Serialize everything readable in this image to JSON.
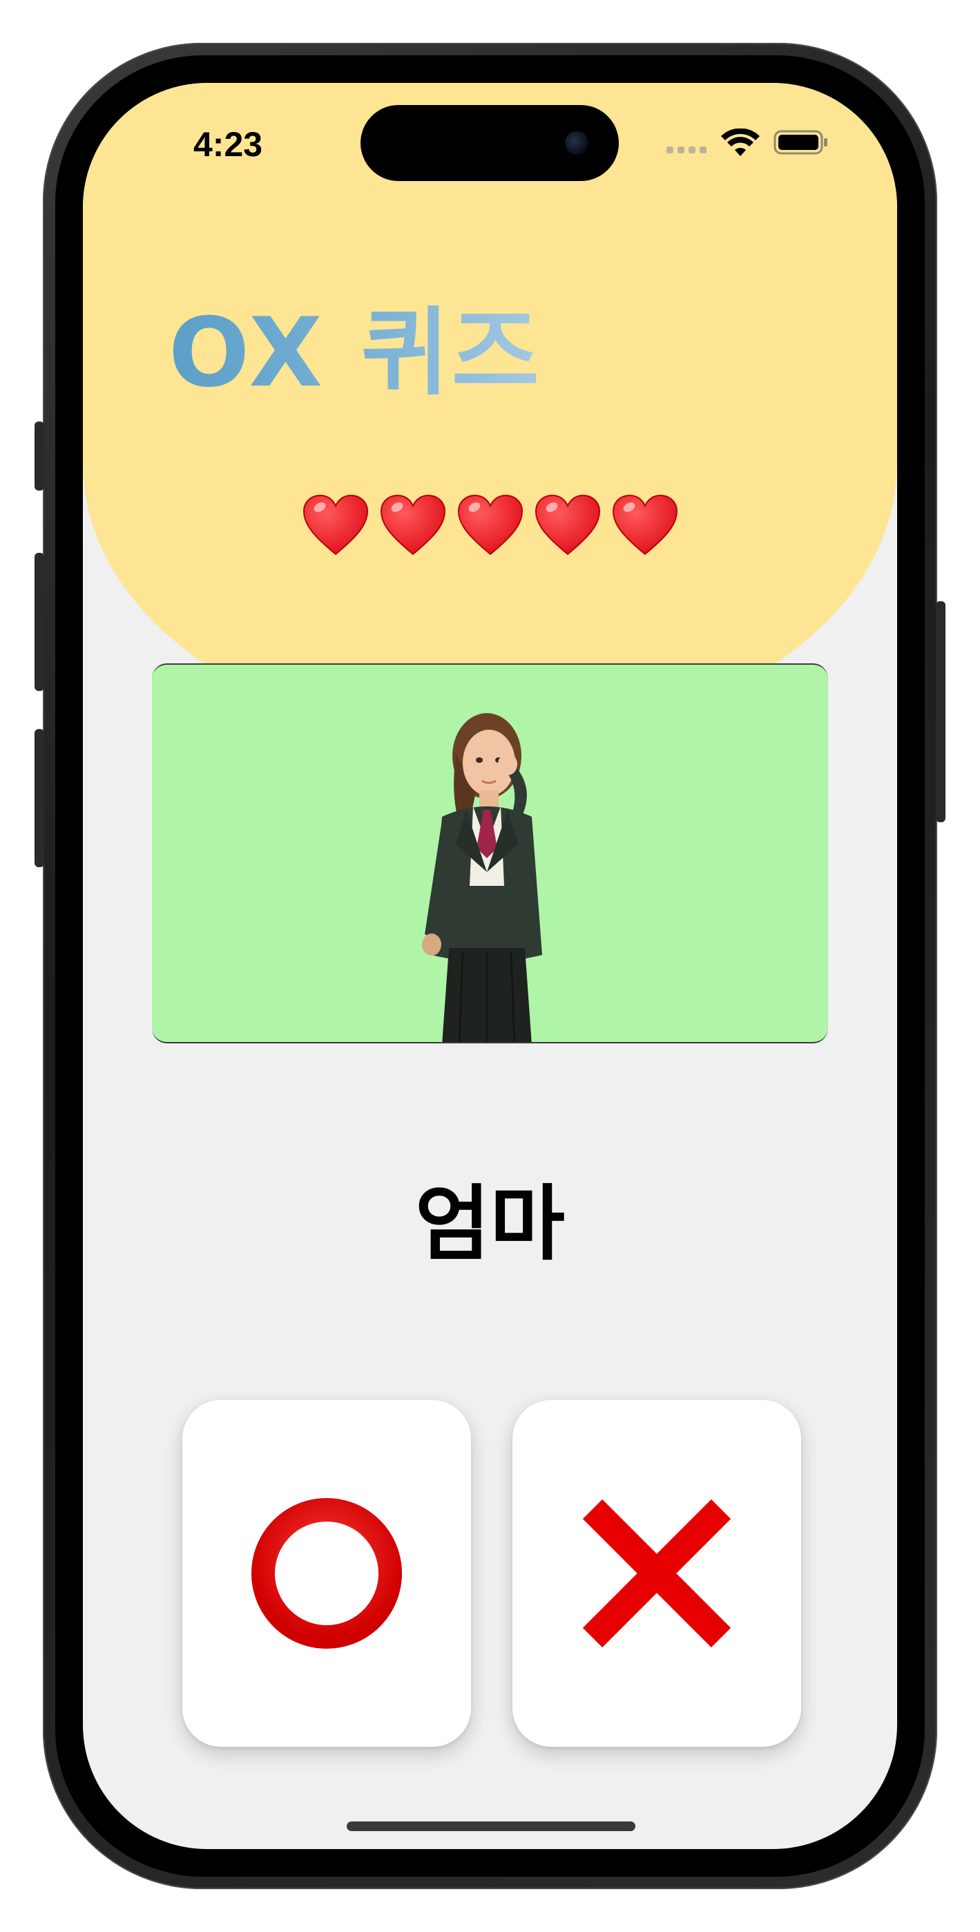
{
  "status_bar": {
    "time": "4:23"
  },
  "quiz": {
    "title": "OX 퀴즈",
    "lives": 5,
    "question_word": "엄마"
  },
  "icons": {
    "heart": "heart-icon",
    "o_answer": "o-circle-icon",
    "x_answer": "x-cross-icon"
  },
  "colors": {
    "header_yellow": "#fde593",
    "title_blue": "#5a9fc8",
    "video_bg": "#b0f4a8",
    "screen_bg": "#f0f0f0",
    "heart_red": "#e0101a",
    "answer_red": "#e60000"
  }
}
